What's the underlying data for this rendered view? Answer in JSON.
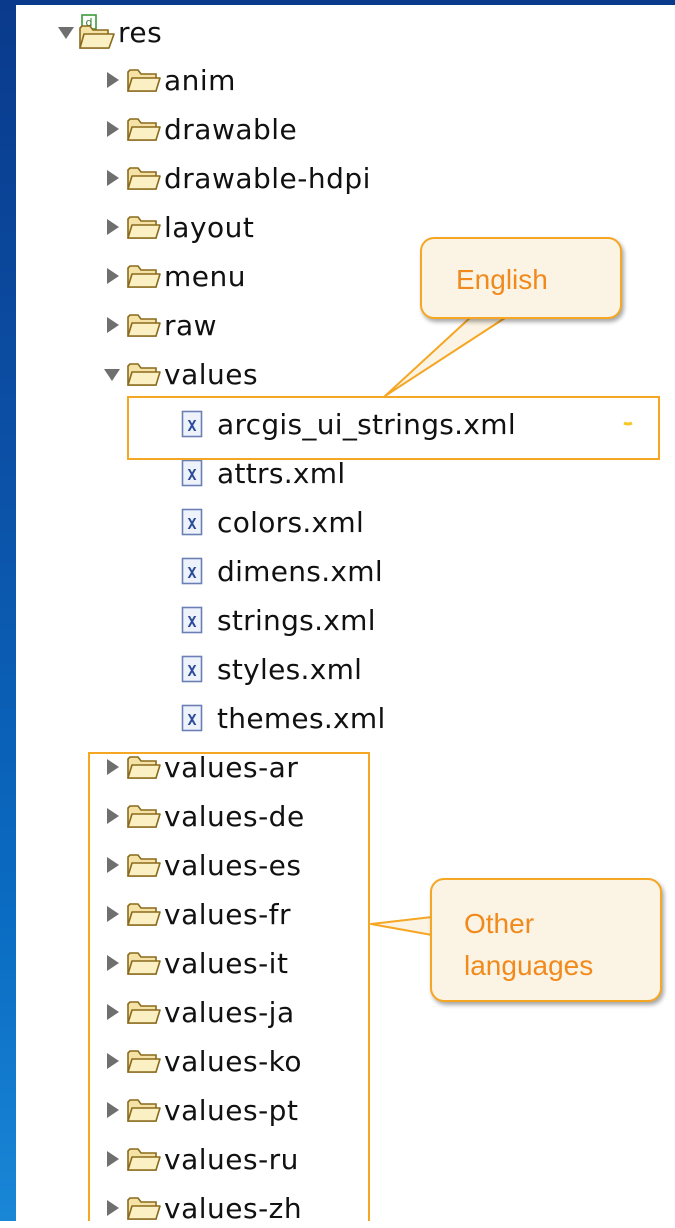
{
  "tree": {
    "root": {
      "label": "res",
      "expanded": true
    },
    "folders_before": [
      {
        "label": "anim",
        "expanded": false
      },
      {
        "label": "drawable",
        "expanded": false
      },
      {
        "label": "drawable-hdpi",
        "expanded": false
      },
      {
        "label": "layout",
        "expanded": false
      },
      {
        "label": "menu",
        "expanded": false
      },
      {
        "label": "raw",
        "expanded": false
      }
    ],
    "values_folder": {
      "label": "values",
      "expanded": true
    },
    "files": [
      {
        "label": "arcgis_ui_strings.xml",
        "icon": "xml-file-icon"
      },
      {
        "label": "attrs.xml",
        "icon": "xml-file-icon"
      },
      {
        "label": "colors.xml",
        "icon": "xml-file-icon"
      },
      {
        "label": "dimens.xml",
        "icon": "xml-file-icon"
      },
      {
        "label": "strings.xml",
        "icon": "xml-file-icon"
      },
      {
        "label": "styles.xml",
        "icon": "xml-file-icon"
      },
      {
        "label": "themes.xml",
        "icon": "xml-file-icon"
      }
    ],
    "language_folders": [
      {
        "label": "values-ar",
        "expanded": false
      },
      {
        "label": "values-de",
        "expanded": false
      },
      {
        "label": "values-es",
        "expanded": false
      },
      {
        "label": "values-fr",
        "expanded": false
      },
      {
        "label": "values-it",
        "expanded": false
      },
      {
        "label": "values-ja",
        "expanded": false
      },
      {
        "label": "values-ko",
        "expanded": false
      },
      {
        "label": "values-pt",
        "expanded": false
      },
      {
        "label": "values-ru",
        "expanded": false
      },
      {
        "label": "values-zh",
        "expanded": false
      }
    ]
  },
  "callouts": {
    "english": "English",
    "other_line1": "Other",
    "other_line2": "languages"
  },
  "colors": {
    "highlight": "#f5a623",
    "callout_text": "#f08a1c",
    "callout_fill": "#fbf4e4",
    "folder_fill": "#f7dc8c",
    "sidebar": "#0b52a8"
  }
}
